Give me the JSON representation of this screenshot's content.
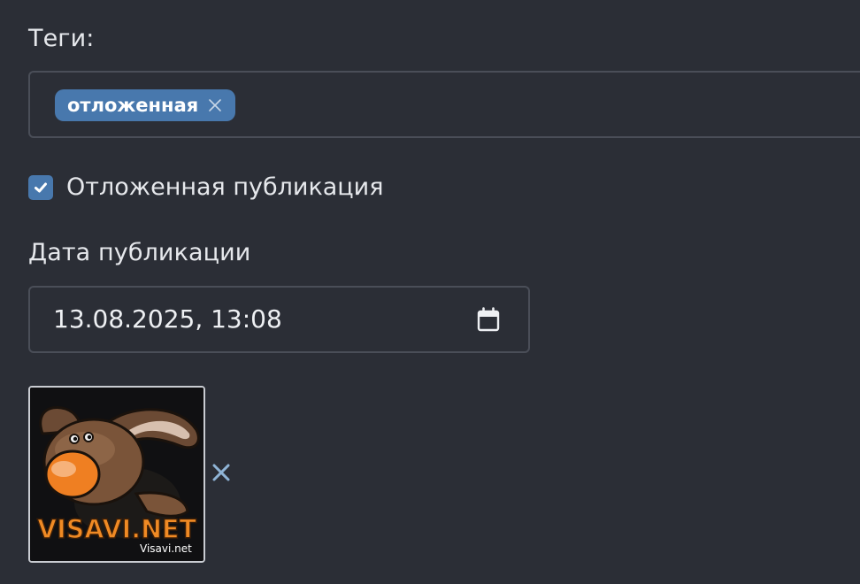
{
  "tags": {
    "label": "Теги:",
    "items": [
      {
        "label": "отложенная"
      }
    ]
  },
  "deferred": {
    "label": "Отложенная публикация",
    "checked": true
  },
  "publish_date": {
    "label": "Дата публикации",
    "value": "13.08.2025, 13:08"
  },
  "image": {
    "brand_text": "VISAVI.NET",
    "small_text": "Visavi.net"
  },
  "colors": {
    "accent": "#4878ad",
    "background": "#2b2e36",
    "remove_x": "#8fb4d6"
  }
}
